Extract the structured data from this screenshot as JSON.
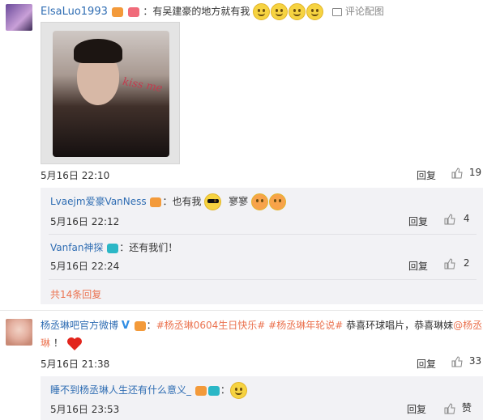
{
  "comment1": {
    "username": "ElsaLuo1993",
    "separator": "：",
    "text": "有吴建豪的地方就有我",
    "pic_link": "评论配图",
    "image_caption": "kiss me",
    "date": "5月16日 22:10",
    "reply_label": "回复",
    "like_count": "19",
    "replies": [
      {
        "username": "Lvaejm爱豪VanNess",
        "separator": "：",
        "text": "也有我",
        "text2": "寥寥",
        "date": "5月16日 22:12",
        "reply_label": "回复",
        "like_count": "4"
      },
      {
        "username": "Vanfan神探",
        "separator": "：",
        "text": "还有我们！",
        "date": "5月16日 22:24",
        "reply_label": "回复",
        "like_count": "2"
      }
    ],
    "total_replies": "共14条回复"
  },
  "comment2": {
    "username": "杨丞琳吧官方微博",
    "separator": "：",
    "hashtag1": "#杨丞琳0604生日快乐#",
    "hashtag2": "#杨丞琳年轮说#",
    "text": "恭喜环球唱片，恭喜琳妹",
    "mention": "@杨丞琳",
    "text_end": "！",
    "date": "5月16日 21:38",
    "reply_label": "回复",
    "like_count": "33",
    "replies": [
      {
        "username": "睡不到杨丞琳人生还有什么意义_",
        "separator": "：",
        "date": "5月16日 23:53",
        "reply_label": "回复",
        "like_label": "赞"
      }
    ]
  },
  "colors": {
    "link": "#eb7350",
    "username": "#2f6db3",
    "reply_bg": "#f2f2f5"
  }
}
